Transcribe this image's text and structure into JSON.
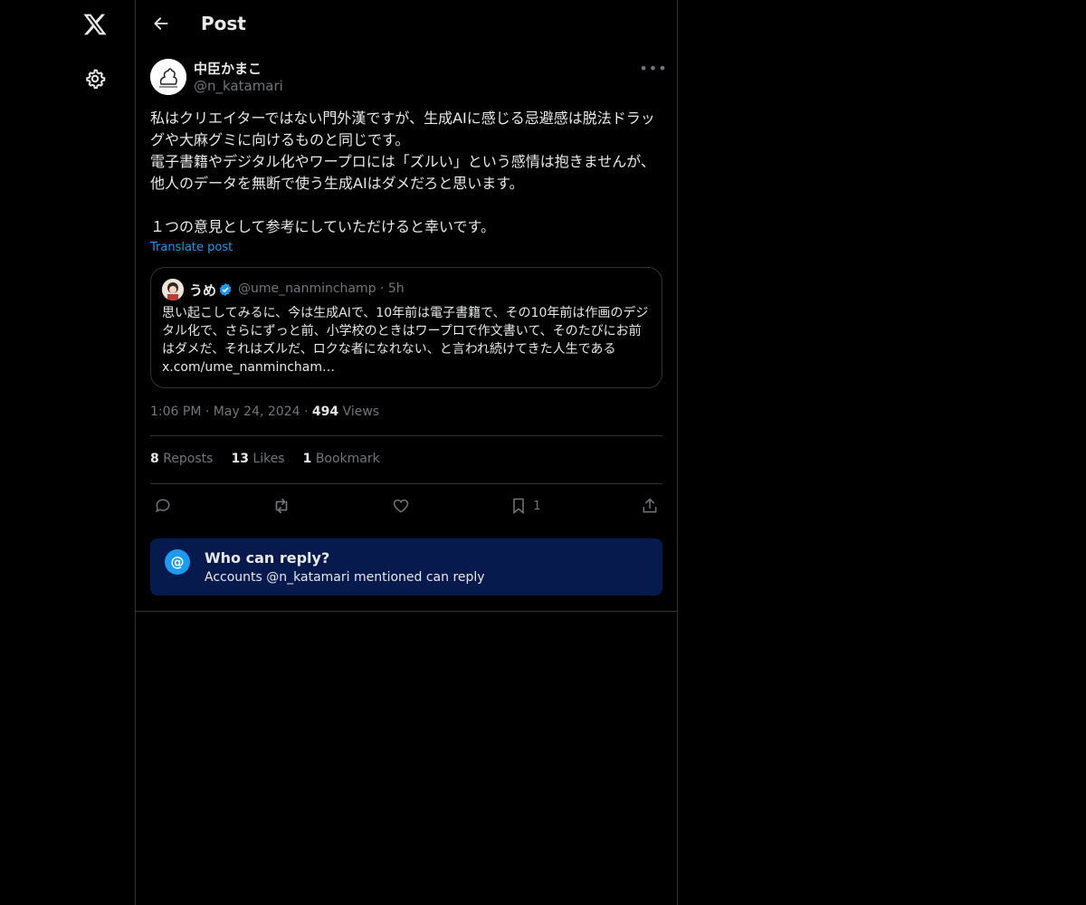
{
  "header": {
    "title": "Post"
  },
  "author": {
    "name": "中臣かまこ",
    "handle": "@n_katamari"
  },
  "post": {
    "text": "私はクリエイターではない門外漢ですが、生成AIに感じる忌避感は脱法ドラッグや大麻グミに向けるものと同じです。\n電子書籍やデジタル化やワープロには「ズルい」という感情は抱きませんが、他人のデータを無断で使う生成AIはダメだろと思います。\n\n１つの意見として参考にしていただけると幸いです。",
    "translate_label": "Translate post"
  },
  "quote": {
    "name": "うめ",
    "handle": "@ume_nanminchamp",
    "separator": "·",
    "time": "5h",
    "text": "思い起こしてみるに、今は生成AIで、10年前は電子書籍で、その10年前は作画のデジタル化で、さらにずっと前、小学校のときはワープロで作文書いて、そのたびにお前はダメだ、それはズルだ、ロクな者になれない、と言われ続けてきた人生である x.com/ume_nanmincham…"
  },
  "meta": {
    "time": "1:06 PM",
    "date": "May 24, 2024",
    "views_count": "494",
    "views_label": "Views",
    "separator": "·"
  },
  "stats": {
    "reposts_count": "8",
    "reposts_label": "Reposts",
    "likes_count": "13",
    "likes_label": "Likes",
    "bookmarks_count": "1",
    "bookmarks_label": "Bookmark"
  },
  "actions": {
    "bookmark_count": "1"
  },
  "reply_restriction": {
    "icon": "@",
    "title": "Who can reply?",
    "subtitle": "Accounts @n_katamari mentioned can reply"
  },
  "colors": {
    "accent": "#1d9bf0",
    "background": "#000000",
    "reply_box": "#071a4d",
    "muted": "#71767b"
  }
}
